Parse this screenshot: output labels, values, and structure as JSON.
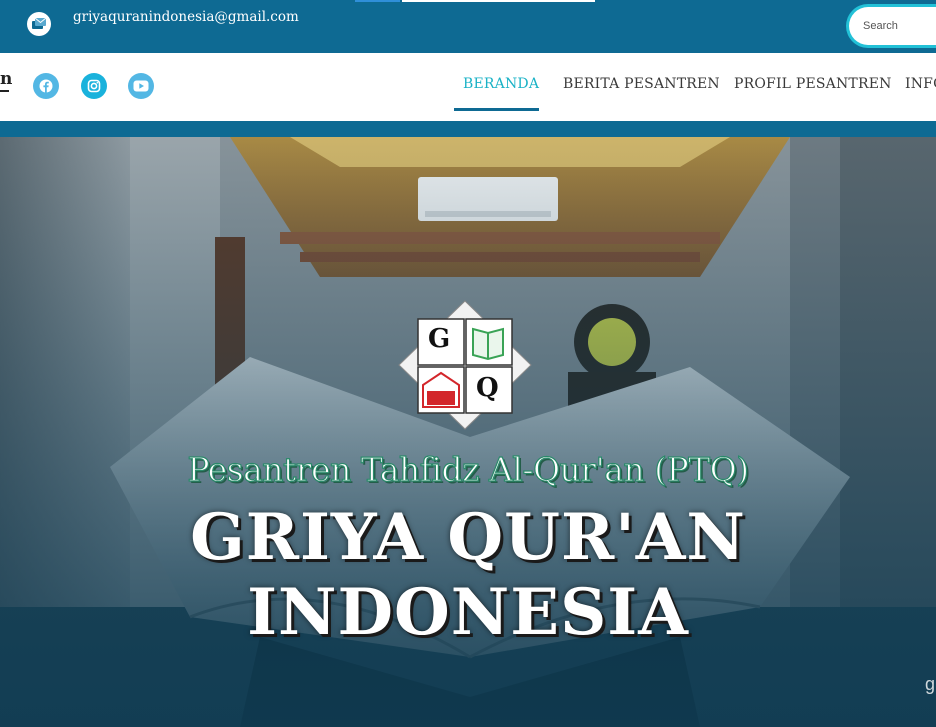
{
  "topbar": {
    "email": "griyaquranindonesia@gmail.com",
    "search_placeholder": "Search",
    "icons": [
      "mail-icon"
    ]
  },
  "navbar": {
    "brand_fragment": "n",
    "social_icons": [
      "facebook-icon",
      "instagram-icon",
      "youtube-icon"
    ],
    "items": [
      {
        "label": "BERANDA",
        "active": true
      },
      {
        "label": "BERITA PESANTREN",
        "active": false
      },
      {
        "label": "PROFIL PESANTREN",
        "active": false
      },
      {
        "label": "INFO",
        "active": false
      }
    ]
  },
  "hero": {
    "logo": {
      "letters": [
        "G",
        "Q"
      ]
    },
    "tagline": "Pesantren Tahfidz Al-Qur'an (PTQ)",
    "title": "GRIYA QUR'AN INDONESIA",
    "corner_glyph": "g"
  },
  "colors": {
    "topbar": "#0e6a93",
    "active_nav": "#1ab2c6",
    "search_border": "#22c1d7",
    "social": "#53b7e4"
  }
}
